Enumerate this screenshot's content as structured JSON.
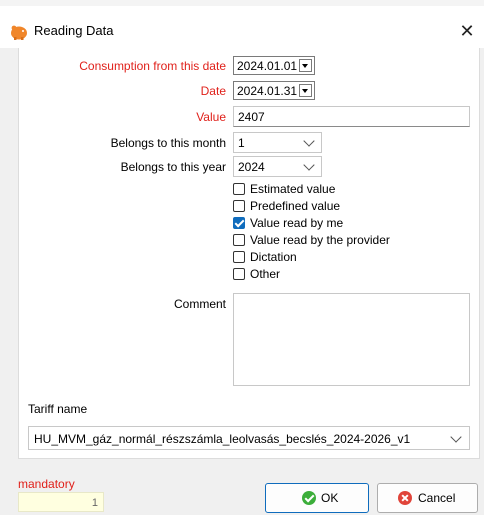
{
  "window": {
    "title": "Reading Data",
    "icon": "piggy-bank-icon",
    "close_icon": "close-icon"
  },
  "form": {
    "consumption_from_label": "Consumption from this date",
    "consumption_from_value": "2024.01.01",
    "date_label": "Date",
    "date_value": "2024.01.31",
    "value_label": "Value",
    "value_value": "2407",
    "month_label": "Belongs to this month",
    "month_value": "1",
    "year_label": "Belongs to this year",
    "year_value": "2024",
    "checkboxes": [
      {
        "label": "Estimated value",
        "checked": false
      },
      {
        "label": "Predefined value",
        "checked": false
      },
      {
        "label": "Value read by me",
        "checked": true
      },
      {
        "label": "Value read by the provider",
        "checked": false
      },
      {
        "label": "Dictation",
        "checked": false
      },
      {
        "label": "Other",
        "checked": false
      }
    ],
    "comment_label": "Comment",
    "comment_value": "",
    "tariff_label": "Tariff name",
    "tariff_value": "HU_MVM_gáz_normál_részszámla_leolvasás_becslés_2024-2026_v1"
  },
  "footer": {
    "mandatory_label": "mandatory",
    "mandatory_count": "1",
    "ok_label": "OK",
    "cancel_label": "Cancel"
  },
  "colors": {
    "required_label": "#e0211b",
    "accent": "#0f6cbd",
    "ok_icon": "#3cae3a",
    "cancel_icon": "#e0443a",
    "mandatory_bg": "#ffffe0"
  }
}
